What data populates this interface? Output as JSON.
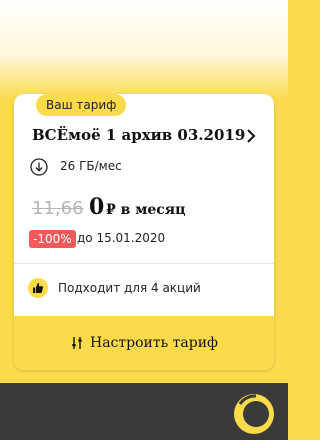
{
  "tariff": {
    "badge": "Ваш тариф",
    "name": "ВСЁмоё 1 архив 03.2019",
    "data_amount": "26 ГБ/мес",
    "old_price": "11,66",
    "new_price": "0",
    "price_unit": "₽ в месяц",
    "discount": "-100%",
    "discount_until": "до 15.01.2020",
    "promo_text": "Подходит для 4 акций",
    "configure_button": "Настроить тариф"
  },
  "colors": {
    "brand_yellow": "#fbda4c",
    "discount_red": "#f05a5a",
    "dark_bar": "#3a3a38"
  },
  "icons": [
    "chevron-right-icon",
    "download-arrow-icon",
    "thumbs-up-icon",
    "sliders-icon",
    "beeline-logo-icon"
  ]
}
